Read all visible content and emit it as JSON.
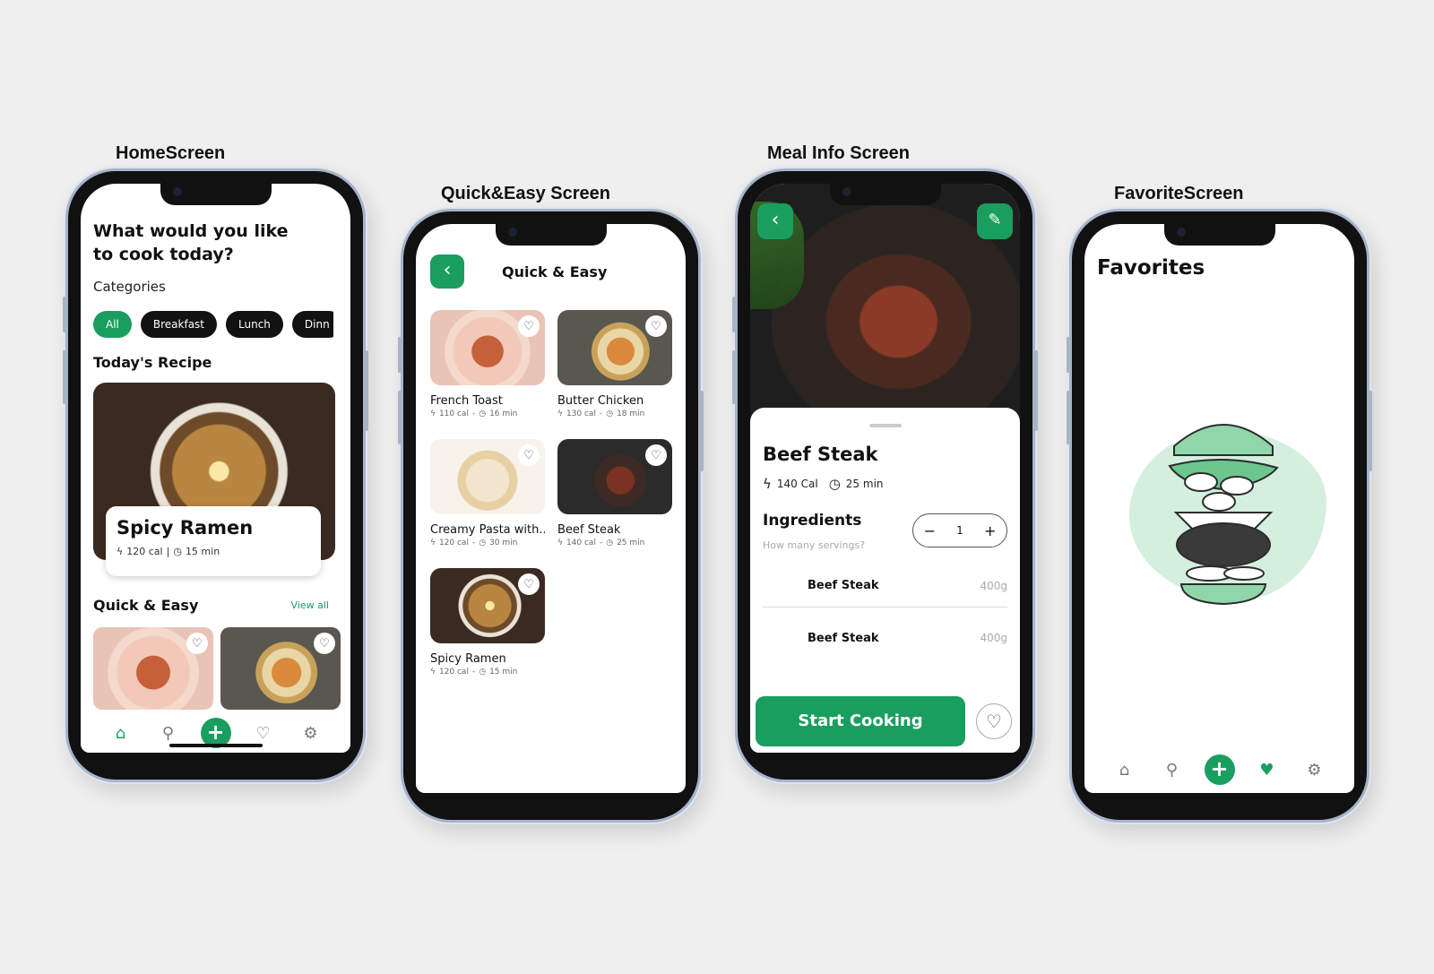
{
  "labels": {
    "home": "HomeScreen",
    "quick": "Quick&Easy Screen",
    "meal": "Meal Info Screen",
    "fav": "FavoriteScreen"
  },
  "home": {
    "greeting": "What would you like to cook today?",
    "categories_title": "Categories",
    "categories": [
      "All",
      "Breakfast",
      "Lunch",
      "Dinn"
    ],
    "today_title": "Today's Recipe",
    "today_recipe": {
      "name": "Spicy Ramen",
      "cal": "120 cal",
      "sep": "|",
      "time": "15 min"
    },
    "quick_title": "Quick & Easy",
    "view_all": "View all"
  },
  "quick": {
    "title": "Quick & Easy",
    "back": "‹",
    "recipes": [
      {
        "name": "French Toast",
        "cal": "110 cal",
        "time": "16 min",
        "photo": "toast"
      },
      {
        "name": "Butter Chicken",
        "cal": "130 cal",
        "time": "18 min",
        "photo": "chicken"
      },
      {
        "name": "Creamy Pasta with...",
        "cal": "120 cal",
        "time": "30 min",
        "photo": "pasta"
      },
      {
        "name": "Beef Steak",
        "cal": "140 cal",
        "time": "25 min",
        "photo": "steak"
      },
      {
        "name": "Spicy Ramen",
        "cal": "120 cal",
        "time": "15 min",
        "photo": "ramen"
      }
    ]
  },
  "meal": {
    "name": "Beef Steak",
    "cal": "140 Cal",
    "time": "25 min",
    "ingredients_title": "Ingredients",
    "servings_q": "How many servings?",
    "servings": "1",
    "minus": "−",
    "plus": "+",
    "ingredients": [
      {
        "name": "Beef Steak",
        "qty": "400g"
      },
      {
        "name": "Beef Steak",
        "qty": "400g"
      }
    ],
    "start_label": "Start Cooking"
  },
  "fav": {
    "title": "Favorites"
  },
  "icons": {
    "bolt": "ϟ",
    "clock": "◷",
    "heart": "♡",
    "heart_filled": "♥",
    "home": "⌂",
    "search": "⚲",
    "plus": "+",
    "gear": "⚙",
    "pencil": "✎"
  },
  "colors": {
    "accent": "#1a9e5f",
    "dark_chip": "#121212"
  }
}
